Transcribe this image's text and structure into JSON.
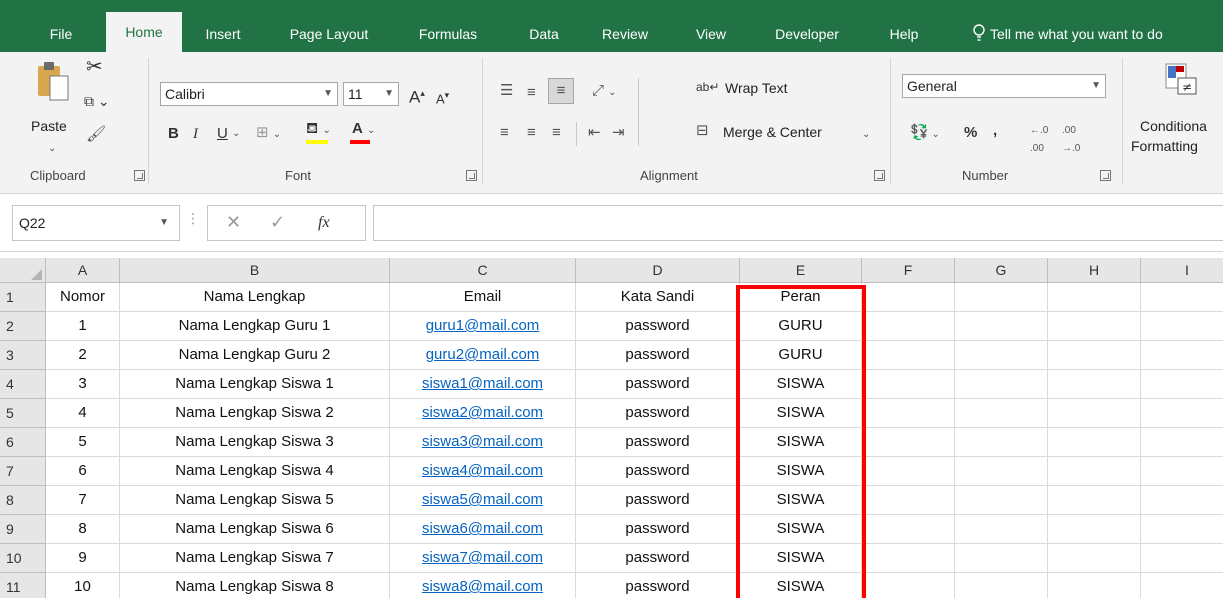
{
  "ribbon_tabs": [
    {
      "label": "File"
    },
    {
      "label": "Home",
      "active": true
    },
    {
      "label": "Insert"
    },
    {
      "label": "Page Layout"
    },
    {
      "label": "Formulas"
    },
    {
      "label": "Data"
    },
    {
      "label": "Review"
    },
    {
      "label": "View"
    },
    {
      "label": "Developer"
    },
    {
      "label": "Help"
    }
  ],
  "tell_me": "Tell me what you want to do",
  "clipboard": {
    "paste_label": "Paste",
    "group_label": "Clipboard"
  },
  "font": {
    "name": "Calibri",
    "size": "11",
    "group_label": "Font",
    "bold": "B",
    "italic": "I",
    "underline": "U",
    "grow": "A",
    "shrink": "A",
    "fill_color": "#ffff00",
    "font_color": "#ff0000"
  },
  "alignment": {
    "wrap_text": "Wrap Text",
    "merge_center": "Merge & Center",
    "group_label": "Alignment"
  },
  "number": {
    "format": "General",
    "percent": "%",
    "comma": ",",
    "group_label": "Number"
  },
  "conditional_formatting": {
    "line1": "Conditiona",
    "line2": "Formatting"
  },
  "formula_bar": {
    "name_box": "Q22",
    "fx": "fx",
    "value": ""
  },
  "columns": [
    "A",
    "B",
    "C",
    "D",
    "E",
    "F",
    "G",
    "H",
    "I"
  ],
  "row_numbers": [
    "1",
    "2",
    "3",
    "4",
    "5",
    "6",
    "7",
    "8",
    "9",
    "10",
    "11"
  ],
  "rows": [
    [
      "Nomor",
      "Nama Lengkap",
      "Email",
      "Kata Sandi",
      "Peran"
    ],
    [
      "1",
      "Nama Lengkap Guru 1",
      "guru1@mail.com",
      "password",
      "GURU"
    ],
    [
      "2",
      "Nama Lengkap Guru 2",
      "guru2@mail.com",
      "password",
      "GURU"
    ],
    [
      "3",
      "Nama Lengkap Siswa 1",
      "siswa1@mail.com",
      "password",
      "SISWA"
    ],
    [
      "4",
      "Nama Lengkap Siswa 2",
      "siswa2@mail.com",
      "password",
      "SISWA"
    ],
    [
      "5",
      "Nama Lengkap Siswa 3",
      "siswa3@mail.com",
      "password",
      "SISWA"
    ],
    [
      "6",
      "Nama Lengkap Siswa 4",
      "siswa4@mail.com",
      "password",
      "SISWA"
    ],
    [
      "7",
      "Nama Lengkap Siswa 5",
      "siswa5@mail.com",
      "password",
      "SISWA"
    ],
    [
      "8",
      "Nama Lengkap Siswa 6",
      "siswa6@mail.com",
      "password",
      "SISWA"
    ],
    [
      "9",
      "Nama Lengkap Siswa 7",
      "siswa7@mail.com",
      "password",
      "SISWA"
    ],
    [
      "10",
      "Nama Lengkap Siswa 8",
      "siswa8@mail.com",
      "password",
      "SISWA"
    ]
  ],
  "colors": {
    "excel_green": "#217346",
    "link": "#0563c1",
    "highlight": "#ff0000"
  }
}
